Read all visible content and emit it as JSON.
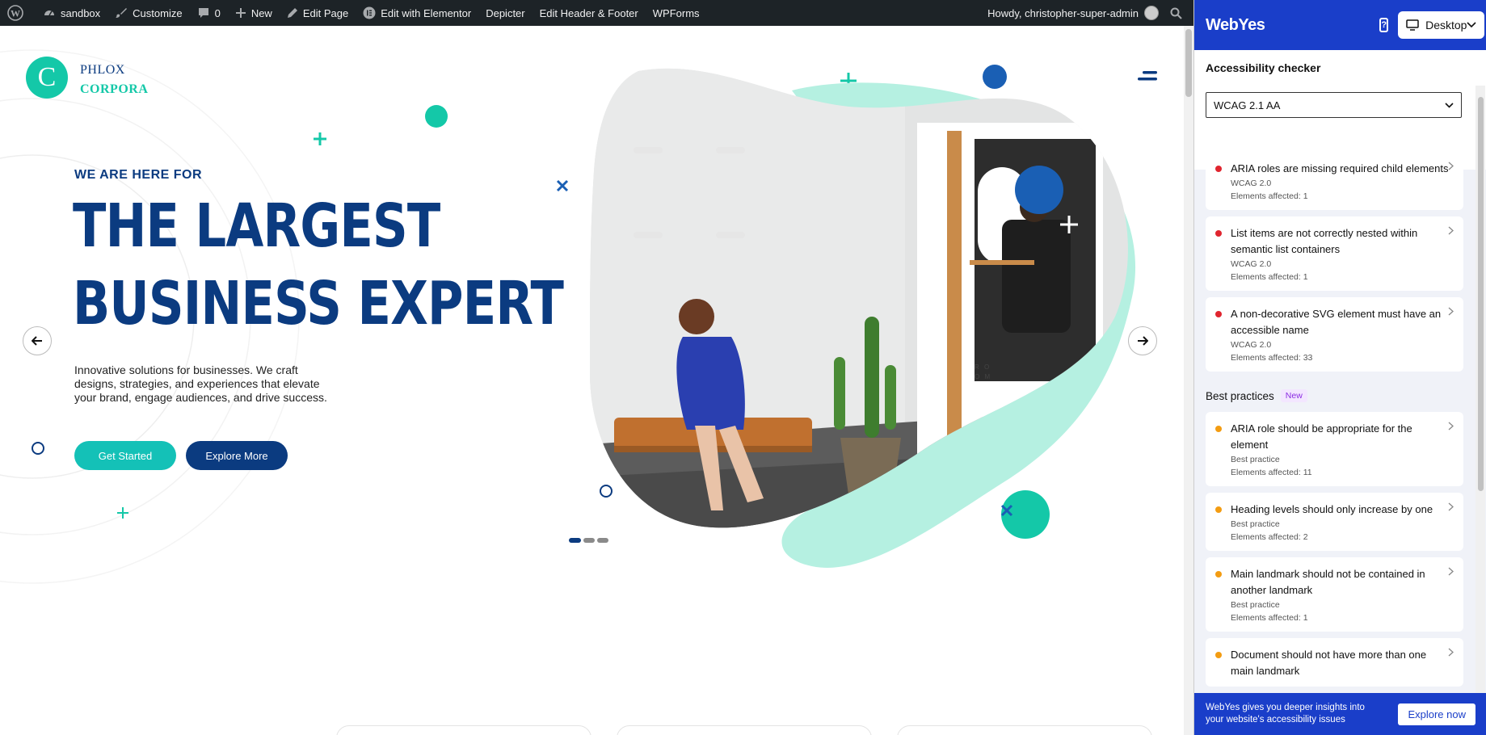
{
  "adminbar": {
    "site": "sandbox",
    "customize": "Customize",
    "comments": "0",
    "new": "New",
    "edit_page": "Edit Page",
    "edit_elementor": "Edit with Elementor",
    "depicter": "Depicter",
    "edit_header_footer": "Edit Header & Footer",
    "wpforms": "WPForms",
    "howdy": "Howdy, christopher-super-admin"
  },
  "hero": {
    "logo_letter": "C",
    "logo_line1": "PHLOX",
    "logo_line2": "CORPORA",
    "eyebrow": "WE ARE HERE FOR",
    "title_line1": "THE LARGEST",
    "title_line2": "BUSINESS EXPERT",
    "description": "Innovative solutions for businesses. We craft designs, strategies, and experiences that elevate your brand, engage audiences, and drive success.",
    "primary_button": "Get Started",
    "secondary_button": "Explore More",
    "image_label_1": "R O",
    "image_label_2": "O M"
  },
  "webyes": {
    "logo": "WebYes",
    "device": "Desktop",
    "section_title": "Accessibility checker",
    "standard": "WCAG 2.1 AA",
    "issues": [
      {
        "title": "ARIA roles are missing required child elements",
        "meta": "WCAG 2.0",
        "affected": "Elements affected: 1"
      },
      {
        "title": "List items are not correctly nested within semantic list containers",
        "meta": "WCAG 2.0",
        "affected": "Elements affected: 1"
      },
      {
        "title": "A non-decorative SVG element must have an accessible name",
        "meta": "WCAG 2.0",
        "affected": "Elements affected: 33"
      }
    ],
    "best_practices_label": "Best practices",
    "new_badge": "New",
    "practices": [
      {
        "title": "ARIA role should be appropriate for the element",
        "meta": "Best practice",
        "affected": "Elements affected: 11"
      },
      {
        "title": "Heading levels should only increase by one",
        "meta": "Best practice",
        "affected": "Elements affected: 2"
      },
      {
        "title": "Main landmark should not be contained in another landmark",
        "meta": "Best practice",
        "affected": "Elements affected: 1"
      },
      {
        "title": "Document should not have more than one main landmark"
      }
    ],
    "footer_text": "WebYes gives you deeper insights into your website's accessibility issues",
    "footer_button": "Explore now"
  },
  "colors": {
    "brand_blue": "#1a3ec9",
    "navy": "#0b3b80",
    "teal": "#14c8a8",
    "error": "#e0252f",
    "warning": "#f39c12"
  }
}
